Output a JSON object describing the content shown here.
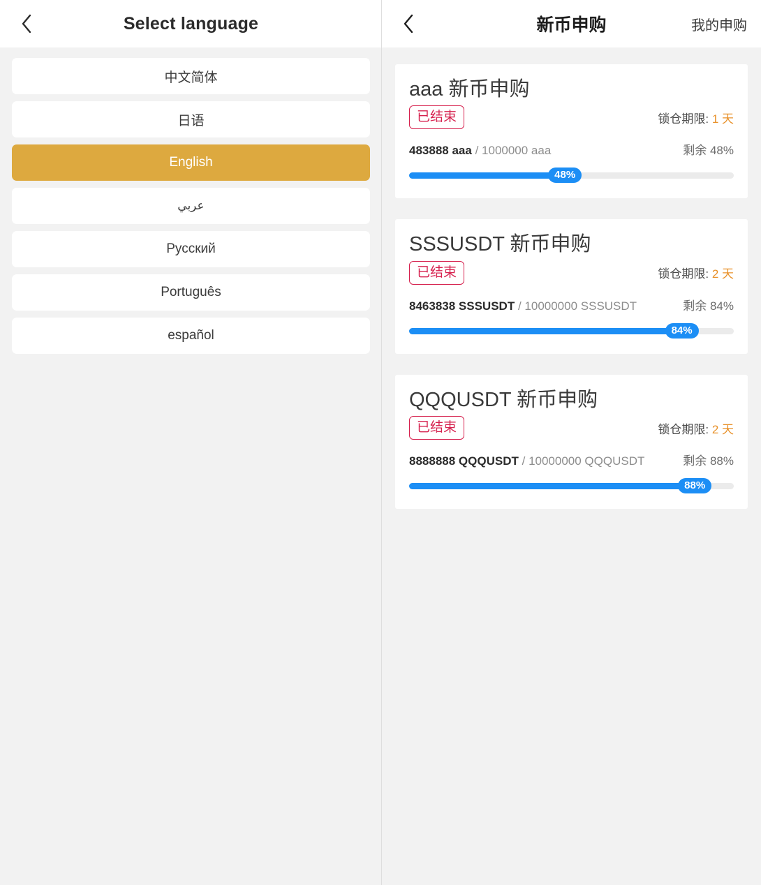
{
  "left": {
    "header": {
      "back_icon": "chevron-left-icon",
      "title": "Select language"
    },
    "languages": [
      {
        "label": "中文简体",
        "selected": false,
        "rtl": false
      },
      {
        "label": "日语",
        "selected": false,
        "rtl": false
      },
      {
        "label": "English",
        "selected": true,
        "rtl": false
      },
      {
        "label": "عربي",
        "selected": false,
        "rtl": true
      },
      {
        "label": "Русский",
        "selected": false,
        "rtl": false
      },
      {
        "label": "Português",
        "selected": false,
        "rtl": false
      },
      {
        "label": "español",
        "selected": false,
        "rtl": false
      }
    ],
    "selected_bg": "#dda93f"
  },
  "right": {
    "header": {
      "back_icon": "chevron-left-icon",
      "title": "新币申购",
      "action_label": "我的申购"
    },
    "colors": {
      "progress_fill": "#1c8ef5",
      "progress_track": "#ebebeb",
      "badge": "#d6214e",
      "lock_days": "#e8912a"
    },
    "cards": [
      {
        "title": "aaa 新币申购",
        "status": "已结束",
        "lock_label": "锁仓期限:",
        "lock_value": "1 天",
        "sold": "483888 aaa",
        "separator": "/",
        "total": "1000000 aaa",
        "remaining_label": "剩余 48%",
        "percent_label": "48%",
        "percent": 48
      },
      {
        "title": "SSSUSDT 新币申购",
        "status": "已结束",
        "lock_label": "锁仓期限:",
        "lock_value": "2 天",
        "sold": "8463838 SSSUSDT",
        "separator": "/",
        "total": "10000000 SSSUSDT",
        "remaining_label": "剩余 84%",
        "percent_label": "84%",
        "percent": 84
      },
      {
        "title": "QQQUSDT 新币申购",
        "status": "已结束",
        "lock_label": "锁仓期限:",
        "lock_value": "2 天",
        "sold": "8888888 QQQUSDT",
        "separator": "/",
        "total": "10000000 QQQUSDT",
        "remaining_label": "剩余 88%",
        "percent_label": "88%",
        "percent": 88
      }
    ]
  }
}
